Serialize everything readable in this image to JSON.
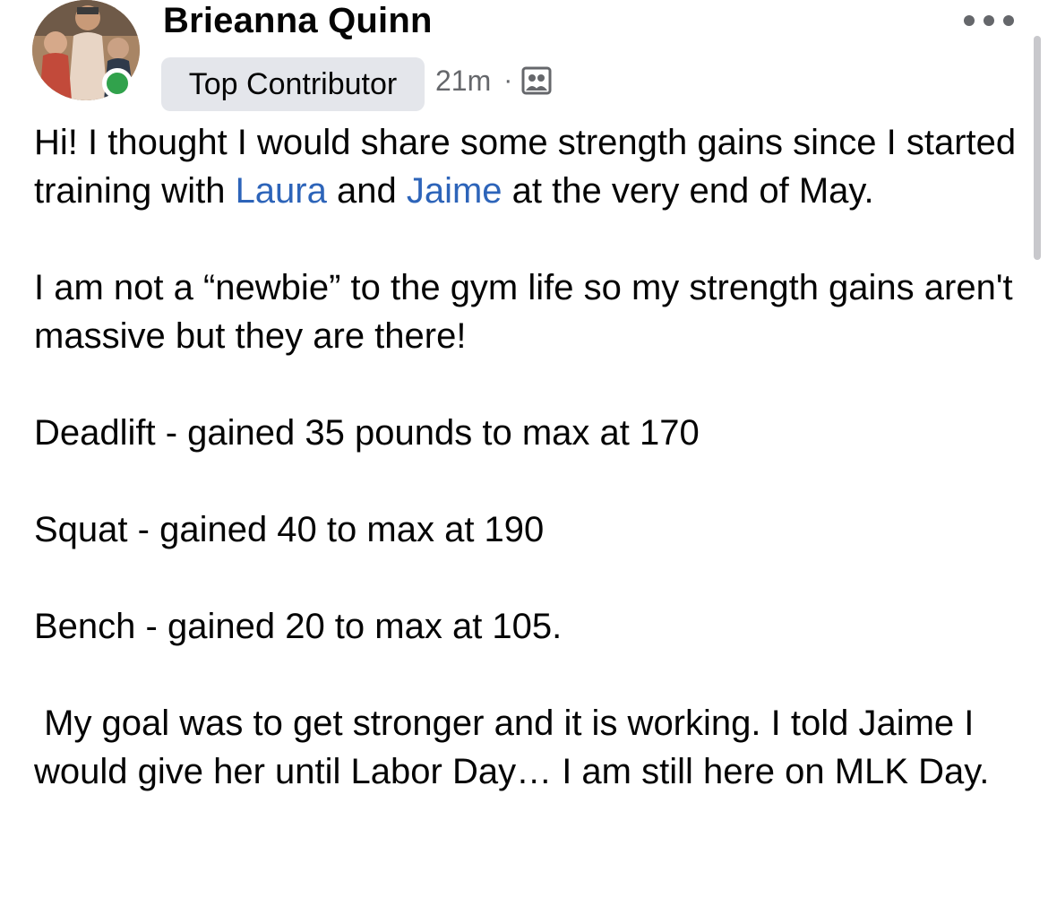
{
  "post": {
    "author": "Brieanna Quinn",
    "badge": "Top Contributor",
    "time": "21m",
    "separator": "·",
    "visibility_icon": "group-icon",
    "paragraph1": {
      "part1": "Hi! I thought I would share some strength gains since I started training with ",
      "mention1": "Laura",
      "part2": " and ",
      "mention2": "Jaime",
      "part3": " at the very end of May."
    },
    "paragraph2": "I am not a “newbie” to the gym life so my strength gains aren't massive but they are there!",
    "paragraph3": "Deadlift - gained 35 pounds to max at 170",
    "paragraph4": "Squat - gained 40 to max at 190",
    "paragraph5": "Bench - gained 20 to max at 105.",
    "paragraph6": " My goal was to get stronger and it is working. I told Jaime I would give her until Labor Day… I am still here on MLK Day."
  },
  "colors": {
    "mention": "#2d64b9",
    "online": "#31a24c",
    "badge_bg": "#e4e6eb",
    "meta_text": "#65676b"
  }
}
